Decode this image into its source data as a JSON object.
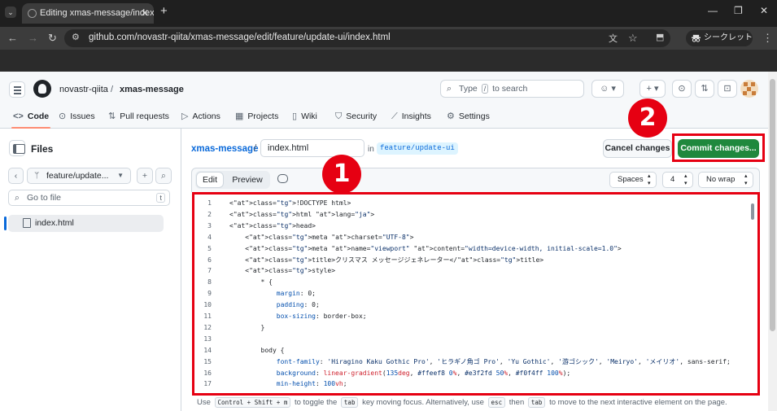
{
  "browser": {
    "tab_title": "Editing xmas-message/index.",
    "url": "github.com/novastr-qiita/xmas-message/edit/feature/update-ui/index.html",
    "incognito_label": "シークレット"
  },
  "header": {
    "owner": "novastr-qiita",
    "separator": "/",
    "repo": "xmas-message",
    "search_prefix": "Type",
    "search_key": "/",
    "search_suffix": "to search",
    "plus_label": "+ ▾"
  },
  "repo_nav": [
    {
      "icon": "<>",
      "label": "Code",
      "active": true
    },
    {
      "icon": "⊙",
      "label": "Issues"
    },
    {
      "icon": "⇅",
      "label": "Pull requests"
    },
    {
      "icon": "▷",
      "label": "Actions"
    },
    {
      "icon": "▦",
      "label": "Projects"
    },
    {
      "icon": "▯",
      "label": "Wiki"
    },
    {
      "icon": "⛉",
      "label": "Security"
    },
    {
      "icon": "⟋",
      "label": "Insights"
    },
    {
      "icon": "⚙",
      "label": "Settings"
    }
  ],
  "files_panel": {
    "title": "Files",
    "branch": "feature/update...",
    "goto_placeholder": "Go to file",
    "goto_key": "t",
    "files": [
      "index.html"
    ]
  },
  "editor": {
    "repo_link": "xmas-message",
    "slash": "/",
    "filename": "index.html",
    "in_label": "in",
    "branch": "feature/update-ui",
    "cancel_label": "Cancel changes",
    "commit_label": "Commit changes...",
    "tab_edit": "Edit",
    "tab_preview": "Preview",
    "indent_mode": "Spaces",
    "indent_size": "4",
    "wrap_mode": "No wrap"
  },
  "code_lines": [
    {
      "n": "1",
      "t": "<!DOCTYPE html>"
    },
    {
      "n": "2",
      "t": "<html lang=\"ja\">"
    },
    {
      "n": "3",
      "t": "<head>"
    },
    {
      "n": "4",
      "t": "    <meta charset=\"UTF-8\">"
    },
    {
      "n": "5",
      "t": "    <meta name=\"viewport\" content=\"width=device-width, initial-scale=1.0\">"
    },
    {
      "n": "6",
      "t": "    <title>クリスマス メッセージジェネレーター</title>"
    },
    {
      "n": "7",
      "t": "    <style>"
    },
    {
      "n": "8",
      "t": "        * {"
    },
    {
      "n": "9",
      "t": "            margin: 0;"
    },
    {
      "n": "10",
      "t": "            padding: 0;"
    },
    {
      "n": "11",
      "t": "            box-sizing: border-box;"
    },
    {
      "n": "12",
      "t": "        }"
    },
    {
      "n": "13",
      "t": ""
    },
    {
      "n": "14",
      "t": "        body {"
    },
    {
      "n": "15",
      "t": "            font-family: 'Hiragino Kaku Gothic Pro', 'ヒラギノ角ゴ Pro', 'Yu Gothic', '游ゴシック', 'Meiryo', 'メイリオ', sans-serif;"
    },
    {
      "n": "16",
      "t": "            background: linear-gradient(135deg, #ffeef8 0%, #e3f2fd 50%, #f0f4ff 100%);"
    },
    {
      "n": "17",
      "t": "            min-height: 100vh;"
    }
  ],
  "hint": {
    "p1": "Use",
    "k1": "Control + Shift + m",
    "p2": "to toggle the",
    "k2": "tab",
    "p3": "key moving focus. Alternatively, use",
    "k3": "esc",
    "p4": "then",
    "k4": "tab",
    "p5": "to move to the next interactive element on the page."
  },
  "annotations": {
    "badge1": "1",
    "badge2": "2"
  },
  "colors": {
    "highlight": "#e60012",
    "commit_green": "#1f883d",
    "link_blue": "#0969da"
  }
}
